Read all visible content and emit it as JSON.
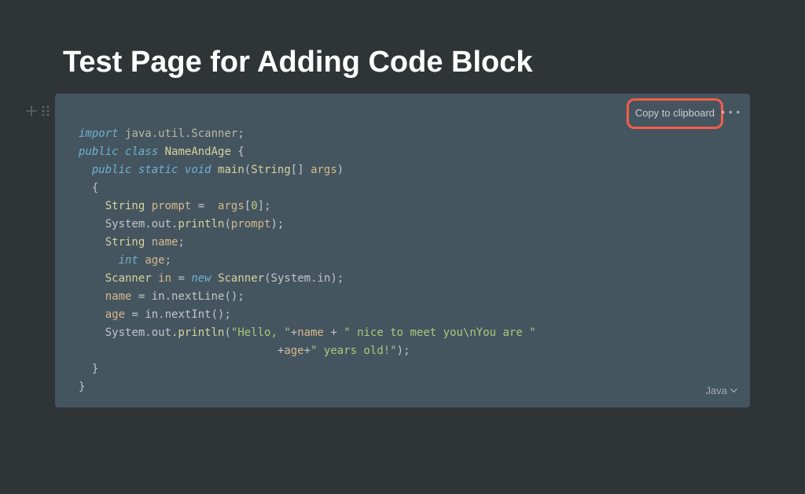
{
  "page": {
    "title": "Test Page for Adding Code Block"
  },
  "codeBlock": {
    "copyLabel": "Copy to clipboard",
    "moreLabel": "•••",
    "language": "Java",
    "tokens": {
      "l1_kw": "import",
      "l1_pkg": "java.util.Scanner",
      "l1_semi": ";",
      "l2_kw1": "public",
      "l2_kw2": "class",
      "l2_cls": "NameAndAge",
      "l2_brace": "{",
      "l3_kw1": "public",
      "l3_kw2": "static",
      "l3_kw3": "void",
      "l3_fn": "main",
      "l3_paren1": "(",
      "l3_type": "String",
      "l3_arr": "[]",
      "l3_param": "args",
      "l3_paren2": ")",
      "l4_brace": "{",
      "l5_type": "String",
      "l5_var": "prompt",
      "l5_eq": "=",
      "l5_rhs": "args",
      "l5_br1": "[",
      "l5_idx": "0",
      "l5_br2": "]",
      "l5_semi": ";",
      "l6_obj": "System.out",
      "l6_fn": ".println",
      "l6_p1": "(",
      "l6_arg": "prompt",
      "l6_p2": ")",
      "l6_semi": ";",
      "l7_type": "String",
      "l7_var": "name",
      "l7_semi": ";",
      "l8_type": "int",
      "l8_var": "age",
      "l8_semi": ";",
      "l9_type": "Scanner",
      "l9_var": "in",
      "l9_eq": "=",
      "l9_new": "new",
      "l9_cls": "Scanner",
      "l9_p1": "(",
      "l9_arg": "System.in",
      "l9_p2": ")",
      "l9_semi": ";",
      "l10_lhs": "name",
      "l10_eq": "=",
      "l10_rhs": "in.nextLine",
      "l10_call": "()",
      "l10_semi": ";",
      "l11_lhs": "age",
      "l11_eq": "=",
      "l11_rhs": "in.nextInt",
      "l11_call": "()",
      "l11_semi": ";",
      "l12_obj": "System.out",
      "l12_fn": ".println",
      "l12_p1": "(",
      "l12_str1": "\"Hello, \"",
      "l12_plus1": "+",
      "l12_var1": "name",
      "l12_plus2": "+",
      "l12_str2": "\" nice to meet you\\nYou are \"",
      "l13_plus1": "+",
      "l13_var": "age",
      "l13_plus2": "+",
      "l13_str": "\" years old!\"",
      "l13_p2": ")",
      "l13_semi": ";",
      "l14_brace": "}",
      "l15_brace": "}"
    }
  },
  "highlight": {
    "color": "#f15e4a"
  }
}
